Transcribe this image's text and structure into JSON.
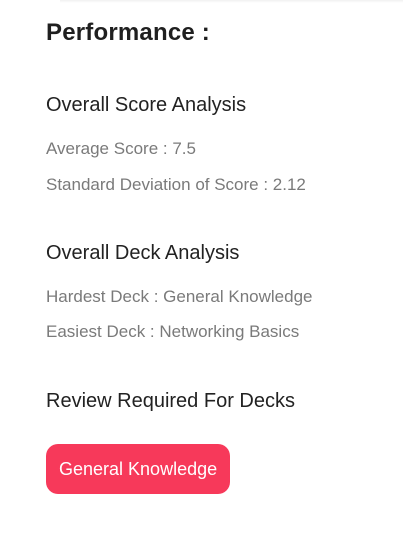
{
  "performance": {
    "title": "Performance :",
    "score_analysis": {
      "heading": "Overall Score Analysis",
      "average_score": "Average Score : 7.5",
      "standard_deviation": "Standard Deviation of Score : 2.12"
    },
    "deck_analysis": {
      "heading": "Overall Deck Analysis",
      "hardest_deck": "Hardest Deck : General Knowledge",
      "easiest_deck": "Easiest Deck : Networking Basics"
    },
    "review": {
      "heading": "Review Required For Decks",
      "decks": [
        "General Knowledge"
      ]
    }
  },
  "colors": {
    "accent": "#f7395a",
    "heading_text": "#1f1f1f",
    "muted_text": "#7a7a7a"
  }
}
